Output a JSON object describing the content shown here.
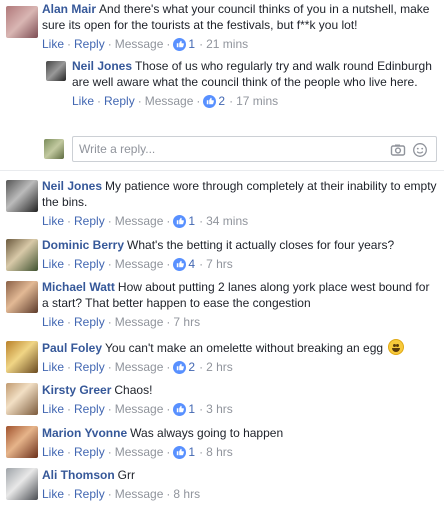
{
  "comments": [
    {
      "author": "Alan Mair",
      "text": "And there's what your council thinks of you in a nutshell, make sure its open for the tourists at the festivals, but f**k you lot!",
      "like": "Like",
      "reply": "Reply",
      "message": "Message",
      "likes": "1",
      "time": "21 mins"
    },
    {
      "author": "Neil Jones",
      "text": "Those of us who regularly try and walk round Edinburgh are well aware what the council think of the people who live here.",
      "like": "Like",
      "reply": "Reply",
      "message": "Message",
      "likes": "2",
      "time": "17 mins"
    },
    {
      "author": "Neil Jones",
      "text": "My patience wore through completely at their inability to empty the bins.",
      "like": "Like",
      "reply": "Reply",
      "message": "Message",
      "likes": "1",
      "time": "34 mins"
    },
    {
      "author": "Dominic Berry",
      "text": "What's the betting it actually closes for four years?",
      "like": "Like",
      "reply": "Reply",
      "message": "Message",
      "likes": "4",
      "time": "7 hrs"
    },
    {
      "author": "Michael Watt",
      "text": "How about putting 2 lanes along york place west bound for a start? That better happen to ease the congestion",
      "like": "Like",
      "reply": "Reply",
      "message": "Message",
      "likes": "",
      "time": "7 hrs"
    },
    {
      "author": "Paul Foley",
      "text": "You can't make an omelette without breaking an egg",
      "like": "Like",
      "reply": "Reply",
      "message": "Message",
      "likes": "2",
      "time": "2 hrs"
    },
    {
      "author": "Kirsty Greer",
      "text": "Chaos!",
      "like": "Like",
      "reply": "Reply",
      "message": "Message",
      "likes": "1",
      "time": "3 hrs"
    },
    {
      "author": "Marion Yvonne",
      "text": "Was always going to happen",
      "like": "Like",
      "reply": "Reply",
      "message": "Message",
      "likes": "1",
      "time": "8 hrs"
    },
    {
      "author": "Ali Thomson",
      "text": "Grr",
      "like": "Like",
      "reply": "Reply",
      "message": "Message",
      "likes": "",
      "time": "8 hrs"
    }
  ],
  "reply_box": {
    "placeholder": "Write a reply..."
  },
  "colors": {
    "link": "#4267b2",
    "author": "#365899",
    "meta": "#90949c",
    "like_badge": "#5890ff"
  },
  "icons": [
    "like-badge-icon",
    "camera-icon",
    "emoji-icon",
    "smile-emoji-icon"
  ]
}
